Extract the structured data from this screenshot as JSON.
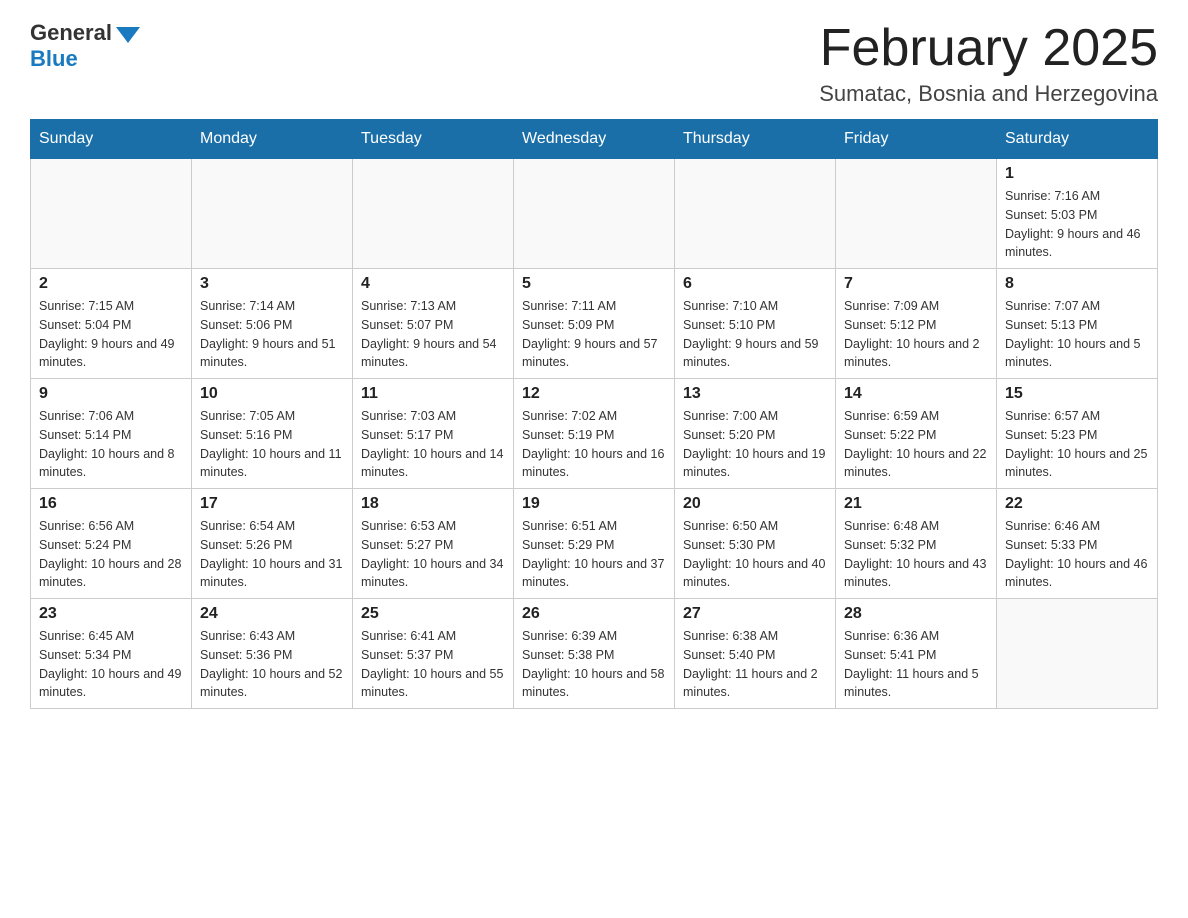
{
  "logo": {
    "general": "General",
    "blue": "Blue"
  },
  "title": {
    "month_year": "February 2025",
    "location": "Sumatac, Bosnia and Herzegovina"
  },
  "weekdays": [
    "Sunday",
    "Monday",
    "Tuesday",
    "Wednesday",
    "Thursday",
    "Friday",
    "Saturday"
  ],
  "weeks": [
    [
      {
        "day": "",
        "info": ""
      },
      {
        "day": "",
        "info": ""
      },
      {
        "day": "",
        "info": ""
      },
      {
        "day": "",
        "info": ""
      },
      {
        "day": "",
        "info": ""
      },
      {
        "day": "",
        "info": ""
      },
      {
        "day": "1",
        "info": "Sunrise: 7:16 AM\nSunset: 5:03 PM\nDaylight: 9 hours and 46 minutes."
      }
    ],
    [
      {
        "day": "2",
        "info": "Sunrise: 7:15 AM\nSunset: 5:04 PM\nDaylight: 9 hours and 49 minutes."
      },
      {
        "day": "3",
        "info": "Sunrise: 7:14 AM\nSunset: 5:06 PM\nDaylight: 9 hours and 51 minutes."
      },
      {
        "day": "4",
        "info": "Sunrise: 7:13 AM\nSunset: 5:07 PM\nDaylight: 9 hours and 54 minutes."
      },
      {
        "day": "5",
        "info": "Sunrise: 7:11 AM\nSunset: 5:09 PM\nDaylight: 9 hours and 57 minutes."
      },
      {
        "day": "6",
        "info": "Sunrise: 7:10 AM\nSunset: 5:10 PM\nDaylight: 9 hours and 59 minutes."
      },
      {
        "day": "7",
        "info": "Sunrise: 7:09 AM\nSunset: 5:12 PM\nDaylight: 10 hours and 2 minutes."
      },
      {
        "day": "8",
        "info": "Sunrise: 7:07 AM\nSunset: 5:13 PM\nDaylight: 10 hours and 5 minutes."
      }
    ],
    [
      {
        "day": "9",
        "info": "Sunrise: 7:06 AM\nSunset: 5:14 PM\nDaylight: 10 hours and 8 minutes."
      },
      {
        "day": "10",
        "info": "Sunrise: 7:05 AM\nSunset: 5:16 PM\nDaylight: 10 hours and 11 minutes."
      },
      {
        "day": "11",
        "info": "Sunrise: 7:03 AM\nSunset: 5:17 PM\nDaylight: 10 hours and 14 minutes."
      },
      {
        "day": "12",
        "info": "Sunrise: 7:02 AM\nSunset: 5:19 PM\nDaylight: 10 hours and 16 minutes."
      },
      {
        "day": "13",
        "info": "Sunrise: 7:00 AM\nSunset: 5:20 PM\nDaylight: 10 hours and 19 minutes."
      },
      {
        "day": "14",
        "info": "Sunrise: 6:59 AM\nSunset: 5:22 PM\nDaylight: 10 hours and 22 minutes."
      },
      {
        "day": "15",
        "info": "Sunrise: 6:57 AM\nSunset: 5:23 PM\nDaylight: 10 hours and 25 minutes."
      }
    ],
    [
      {
        "day": "16",
        "info": "Sunrise: 6:56 AM\nSunset: 5:24 PM\nDaylight: 10 hours and 28 minutes."
      },
      {
        "day": "17",
        "info": "Sunrise: 6:54 AM\nSunset: 5:26 PM\nDaylight: 10 hours and 31 minutes."
      },
      {
        "day": "18",
        "info": "Sunrise: 6:53 AM\nSunset: 5:27 PM\nDaylight: 10 hours and 34 minutes."
      },
      {
        "day": "19",
        "info": "Sunrise: 6:51 AM\nSunset: 5:29 PM\nDaylight: 10 hours and 37 minutes."
      },
      {
        "day": "20",
        "info": "Sunrise: 6:50 AM\nSunset: 5:30 PM\nDaylight: 10 hours and 40 minutes."
      },
      {
        "day": "21",
        "info": "Sunrise: 6:48 AM\nSunset: 5:32 PM\nDaylight: 10 hours and 43 minutes."
      },
      {
        "day": "22",
        "info": "Sunrise: 6:46 AM\nSunset: 5:33 PM\nDaylight: 10 hours and 46 minutes."
      }
    ],
    [
      {
        "day": "23",
        "info": "Sunrise: 6:45 AM\nSunset: 5:34 PM\nDaylight: 10 hours and 49 minutes."
      },
      {
        "day": "24",
        "info": "Sunrise: 6:43 AM\nSunset: 5:36 PM\nDaylight: 10 hours and 52 minutes."
      },
      {
        "day": "25",
        "info": "Sunrise: 6:41 AM\nSunset: 5:37 PM\nDaylight: 10 hours and 55 minutes."
      },
      {
        "day": "26",
        "info": "Sunrise: 6:39 AM\nSunset: 5:38 PM\nDaylight: 10 hours and 58 minutes."
      },
      {
        "day": "27",
        "info": "Sunrise: 6:38 AM\nSunset: 5:40 PM\nDaylight: 11 hours and 2 minutes."
      },
      {
        "day": "28",
        "info": "Sunrise: 6:36 AM\nSunset: 5:41 PM\nDaylight: 11 hours and 5 minutes."
      },
      {
        "day": "",
        "info": ""
      }
    ]
  ]
}
